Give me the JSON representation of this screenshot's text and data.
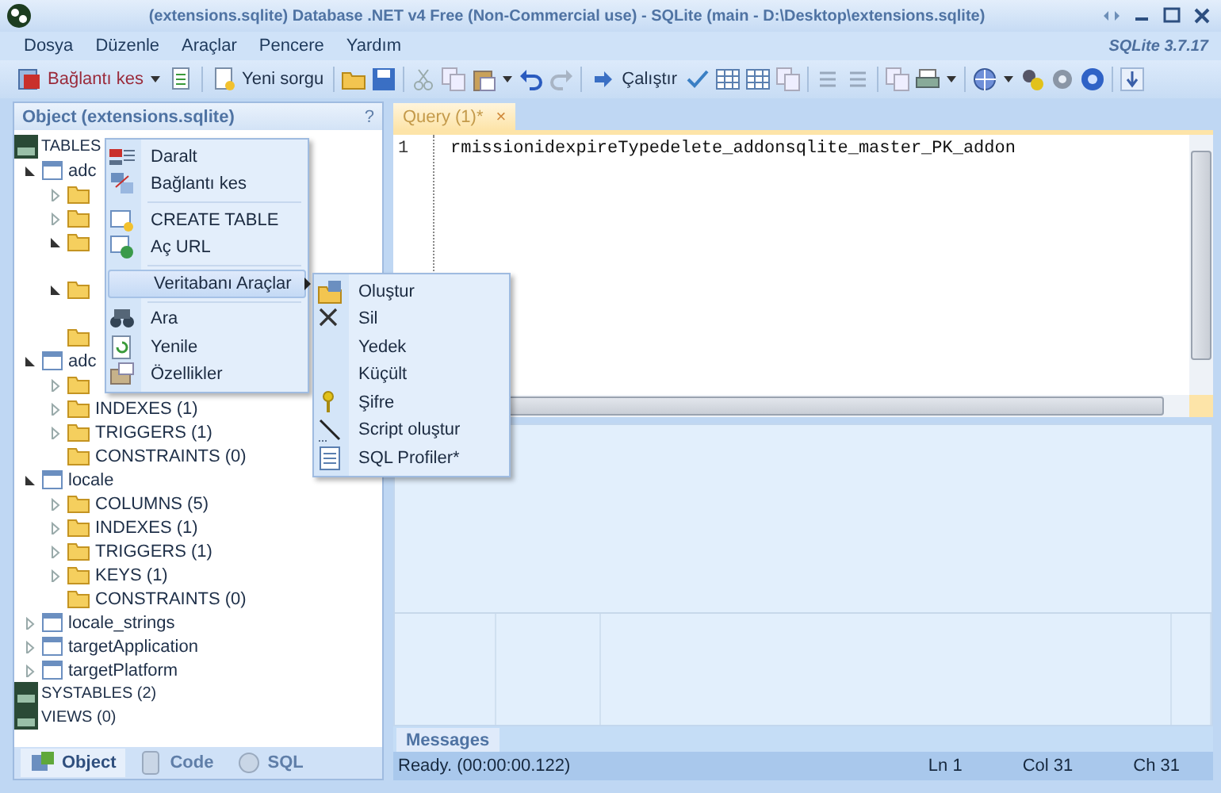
{
  "window": {
    "title": "(extensions.sqlite) Database .NET v4 Free (Non-Commercial use) - SQLite  (main - D:\\Desktop\\extensions.sqlite)",
    "brand": "SQLite 3.7.17"
  },
  "menu": [
    "Dosya",
    "Düzenle",
    "Araçlar",
    "Pencere",
    "Yardım"
  ],
  "toolbar": {
    "buttons": [
      {
        "label": "Bağlantı kes"
      },
      {
        "label": "Yeni sorgu"
      },
      {
        "label": "Çalıştır"
      }
    ]
  },
  "object_panel": {
    "title": "Object (extensions.sqlite)",
    "help": "?",
    "tree": [
      {
        "label": "TABLES",
        "kind": "group",
        "expanded": true,
        "children": [
          {
            "label": "adc",
            "kind": "table",
            "expanded": true,
            "children": [
              {
                "kind": "folder",
                "expanded": false
              },
              {
                "kind": "folder",
                "expanded": false
              },
              {
                "kind": "folder",
                "expanded": true
              },
              {
                "kind": "folder",
                "expanded": true
              },
              {
                "kind": "folder"
              }
            ]
          },
          {
            "label": "adc",
            "kind": "table",
            "expanded": true,
            "children": [
              {
                "kind": "folder",
                "expanded": false
              },
              {
                "label": "INDEXES (1)",
                "kind": "folder",
                "expanded": false
              },
              {
                "label": "TRIGGERS (1)",
                "kind": "folder",
                "expanded": false
              },
              {
                "label": "CONSTRAINTS (0)",
                "kind": "folder"
              }
            ]
          },
          {
            "label": "locale",
            "kind": "table",
            "expanded": true,
            "children": [
              {
                "label": "COLUMNS (5)",
                "kind": "folder",
                "expanded": false
              },
              {
                "label": "INDEXES (1)",
                "kind": "folder",
                "expanded": false
              },
              {
                "label": "TRIGGERS (1)",
                "kind": "folder",
                "expanded": false
              },
              {
                "label": "KEYS (1)",
                "kind": "folder",
                "expanded": false
              },
              {
                "label": "CONSTRAINTS (0)",
                "kind": "folder"
              }
            ]
          },
          {
            "label": "locale_strings",
            "kind": "table",
            "expanded": false
          },
          {
            "label": "targetApplication",
            "kind": "table",
            "expanded": false
          },
          {
            "label": "targetPlatform",
            "kind": "table",
            "expanded": false
          }
        ]
      },
      {
        "label": "SYSTABLES (2)",
        "kind": "group"
      },
      {
        "label": "VIEWS (0)",
        "kind": "group"
      }
    ],
    "tabs": [
      {
        "label": "Object",
        "selected": true
      },
      {
        "label": "Code",
        "selected": false
      },
      {
        "label": "SQL",
        "selected": false
      }
    ]
  },
  "editor": {
    "tabs": [
      {
        "label": "Query (1)*",
        "selected": true,
        "close": "×"
      }
    ],
    "lines": [
      {
        "number": "1",
        "text": "rmissionidexpireTypedelete_addonsqlite_master_PK_addon"
      }
    ]
  },
  "messages": {
    "tab": "Messages"
  },
  "status_bar": {
    "message": "Ready. (00:00:00.122)",
    "ln": "Ln 1",
    "col": "Col 31",
    "ch": "Ch 31"
  },
  "context_menu": {
    "items": [
      {
        "kind": "item",
        "label": "Daralt",
        "highlighted": false
      },
      {
        "kind": "item",
        "label": "Bağlantı kes",
        "highlighted": false
      },
      {
        "kind": "separator"
      },
      {
        "kind": "item",
        "label": "CREATE TABLE",
        "highlighted": false
      },
      {
        "kind": "item",
        "label": "Aç URL",
        "highlighted": false
      },
      {
        "kind": "separator"
      },
      {
        "kind": "item",
        "label": "Veritabanı Araçlar",
        "highlighted": true,
        "submenu": true
      },
      {
        "kind": "separator"
      },
      {
        "kind": "item",
        "label": "Ara",
        "highlighted": false
      },
      {
        "kind": "item",
        "label": "Yenile",
        "highlighted": false
      },
      {
        "kind": "item",
        "label": "Özellikler",
        "highlighted": false
      }
    ],
    "submenu": [
      {
        "label": "Oluştur"
      },
      {
        "label": "Sil"
      },
      {
        "label": "Yedek"
      },
      {
        "label": "Küçült"
      },
      {
        "label": "Şifre"
      },
      {
        "label": "Script oluştur"
      },
      {
        "label": "SQL Profiler*"
      }
    ]
  }
}
